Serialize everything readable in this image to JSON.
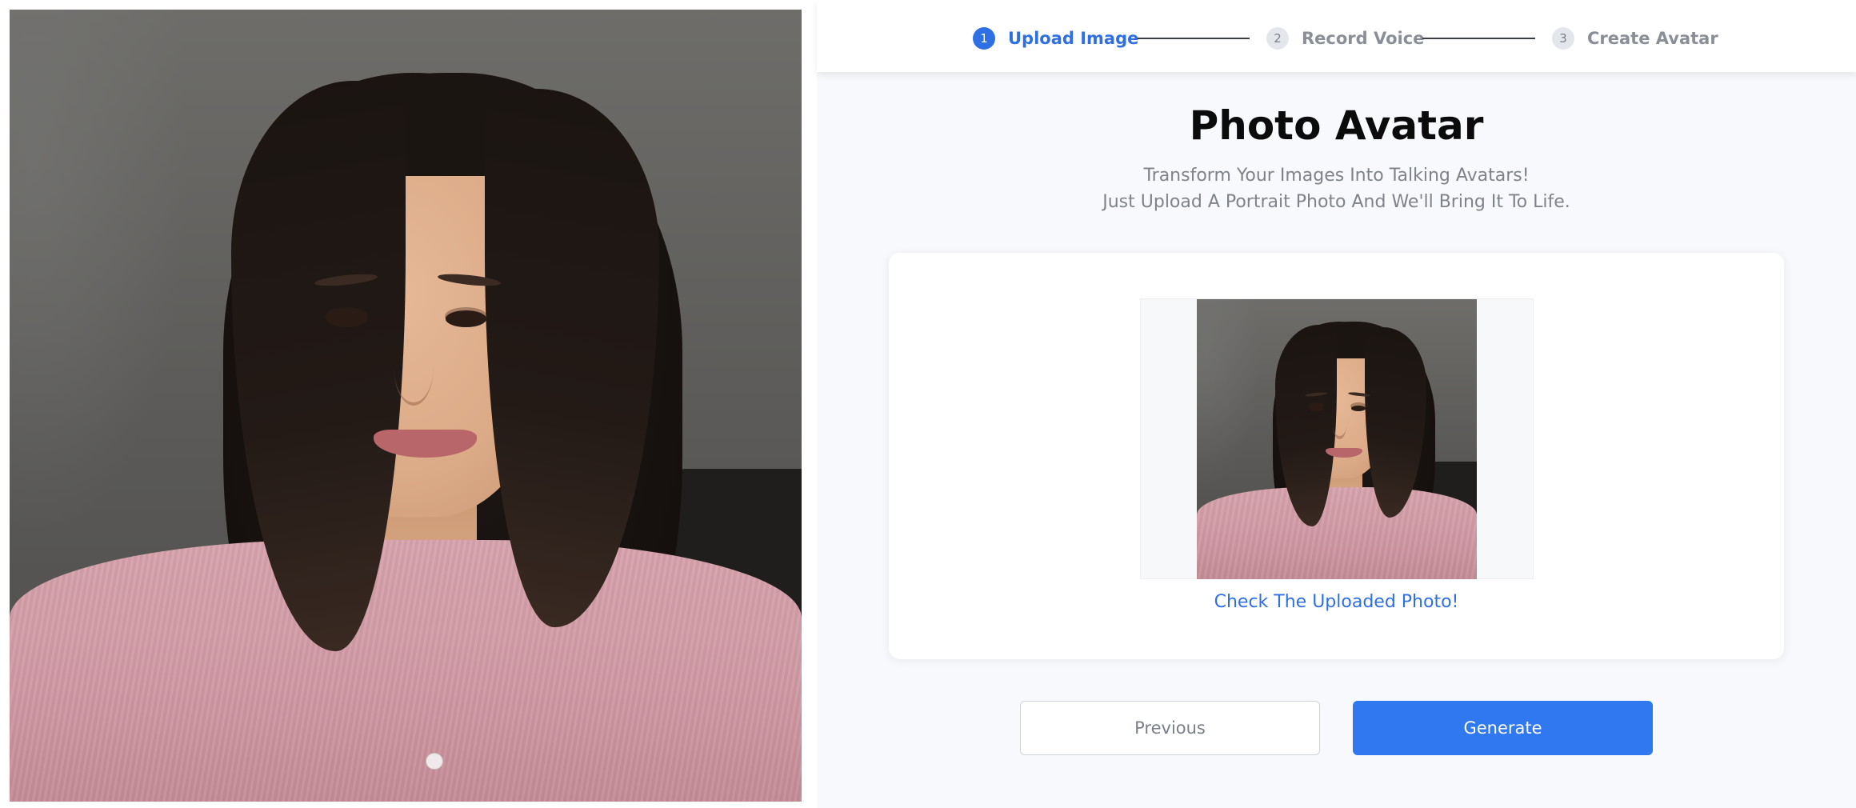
{
  "stepper": {
    "steps": [
      {
        "number": "1",
        "label": "Upload Image"
      },
      {
        "number": "2",
        "label": "Record Voice"
      },
      {
        "number": "3",
        "label": "Create Avatar"
      }
    ],
    "active_step": 1
  },
  "main": {
    "title": "Photo Avatar",
    "subtitle_line1": "Transform Your Images Into Talking Avatars!",
    "subtitle_line2": "Just Upload A Portrait Photo And We'll Bring It To Life.",
    "check_photo_label": "Check The Uploaded Photo!"
  },
  "actions": {
    "previous_label": "Previous",
    "generate_label": "Generate"
  },
  "colors": {
    "accent": "#2f6fe4",
    "primary_button": "#2f78f0",
    "inactive_step": "#8a8f97"
  },
  "icons": {
    "step_active": "step-number-badge-active",
    "step_inactive": "step-number-badge-inactive"
  }
}
